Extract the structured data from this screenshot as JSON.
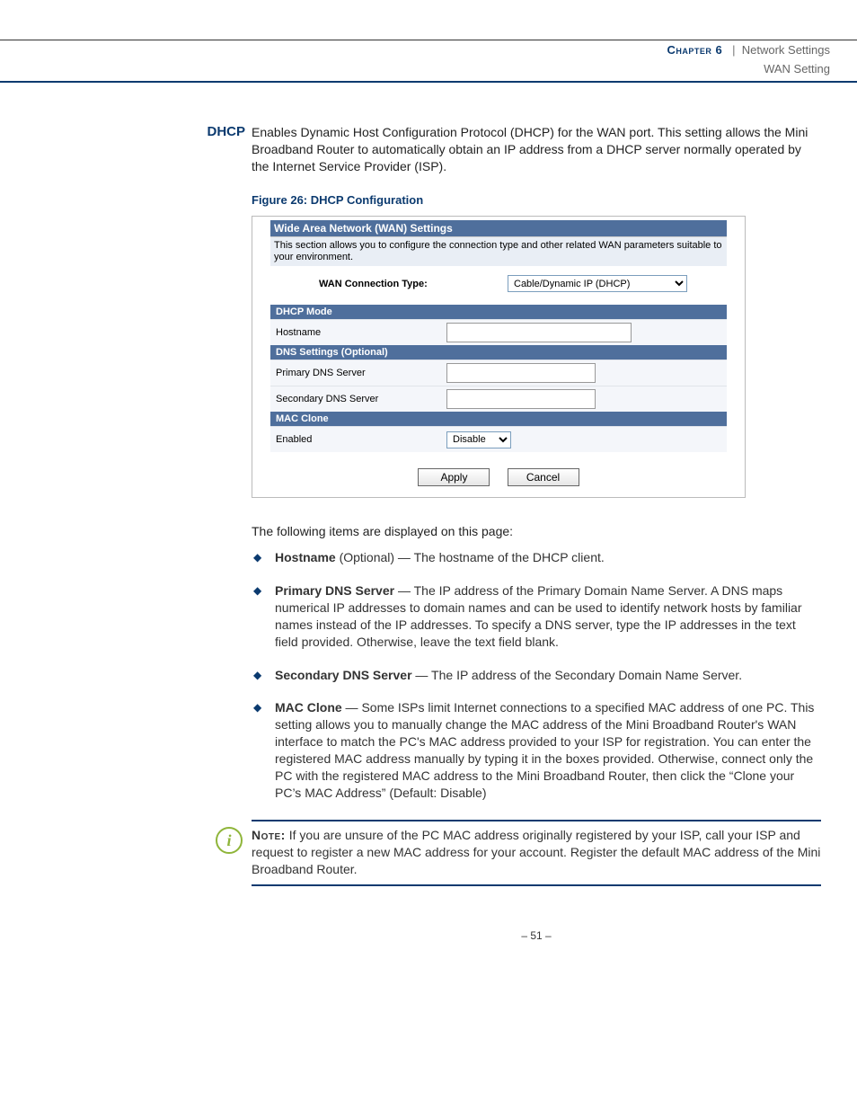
{
  "header": {
    "chapter": "Chapter 6",
    "sep": "|",
    "title": "Network Settings",
    "subtitle": "WAN Setting"
  },
  "section": {
    "label": "DHCP",
    "intro": "Enables Dynamic Host Configuration Protocol (DHCP) for the WAN port. This setting allows the Mini Broadband Router to automatically obtain an IP address from a DHCP server normally operated by the Internet Service Provider (ISP).",
    "figure_caption": "Figure 26:  DHCP Configuration"
  },
  "figure": {
    "title_bar": "Wide Area Network (WAN) Settings",
    "desc": "This section allows you to configure the connection type and other related WAN parameters suitable to your environment.",
    "conn_type_label": "WAN Connection Type:",
    "conn_type_value": "Cable/Dynamic IP (DHCP)",
    "dhcp_head": "DHCP Mode",
    "hostname_label": "Hostname",
    "dns_head": "DNS Settings (Optional)",
    "primary_dns_label": "Primary DNS Server",
    "secondary_dns_label": "Secondary DNS Server",
    "mac_head": "MAC Clone",
    "mac_enabled_label": "Enabled",
    "mac_enabled_value": "Disable",
    "apply": "Apply",
    "cancel": "Cancel"
  },
  "body": {
    "lead": "The following items are displayed on this page:",
    "items": [
      {
        "term": "Hostname",
        "rest": " (Optional) — The hostname of the DHCP client."
      },
      {
        "term": "Primary DNS Server",
        "rest": " — The IP address of the Primary Domain Name Server. A DNS maps numerical IP addresses to domain names and can be used to identify network hosts by familiar names instead of the IP addresses. To specify a DNS server, type the IP addresses in the text field provided. Otherwise, leave the text field blank."
      },
      {
        "term": "Secondary DNS Server",
        "rest": " — The IP address of the Secondary Domain Name Server."
      },
      {
        "term": "MAC Clone",
        "rest": " — Some ISPs limit Internet connections to a specified MAC address of one PC. This setting allows you to manually change the MAC address of the Mini Broadband Router's WAN interface to match the PC's MAC address provided to your ISP for registration. You can enter the registered MAC address manually by typing it in the boxes provided. Otherwise, connect only the PC with the registered MAC address to the Mini Broadband Router, then click the “Clone your PC’s MAC Address” (Default: Disable)"
      }
    ]
  },
  "note": {
    "label": "Note:",
    "text": " If you are unsure of the PC MAC address originally registered by your ISP, call your ISP and request to register a new MAC address for your account. Register the default MAC address of the Mini Broadband Router."
  },
  "page_num": "–  51  –"
}
